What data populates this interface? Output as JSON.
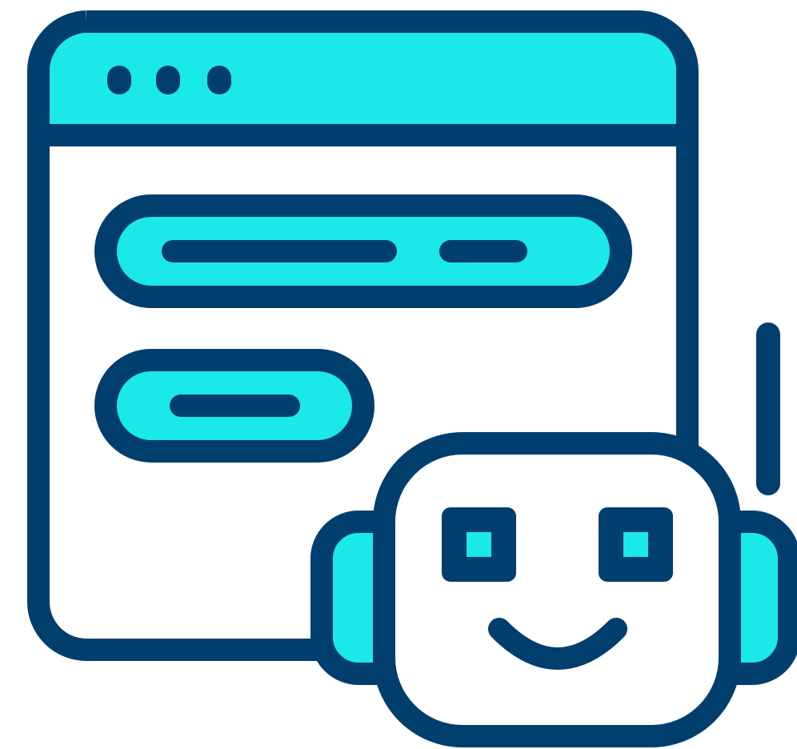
{
  "illustration": {
    "subject": "chatbot-icon",
    "icons": {
      "window": "browser-window-icon",
      "robot": "robot-head-icon"
    },
    "colors": {
      "outline": "#003e6e",
      "accent": "#1be8e8",
      "background": "#ffffff"
    }
  }
}
